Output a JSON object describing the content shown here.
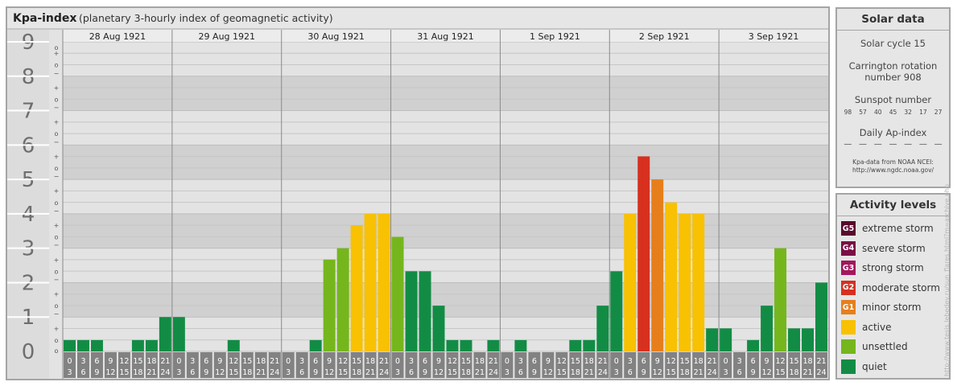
{
  "title": "Kpa-index",
  "subtitle": "(planetary 3-hourly index of geomagnetic activity)",
  "chart_data": {
    "type": "bar",
    "title": "Kpa-index",
    "subtitle": "(planetary 3-hourly index of geomagnetic activity)",
    "ylim": [
      0,
      9
    ],
    "y_ticks": [
      "0",
      "1",
      "2",
      "3",
      "4",
      "5",
      "6",
      "7",
      "8",
      "9"
    ],
    "y_subticks": [
      "+",
      "o",
      "−"
    ],
    "days": [
      "28 Aug 1921",
      "29 Aug 1921",
      "30 Aug 1921",
      "31 Aug 1921",
      "1 Sep 1921",
      "2 Sep 1921",
      "3 Sep 1921"
    ],
    "interval_starts": [
      "0",
      "3",
      "6",
      "9",
      "12",
      "15",
      "18",
      "21"
    ],
    "interval_ends": [
      "3",
      "6",
      "9",
      "12",
      "15",
      "18",
      "21",
      "24"
    ],
    "values": [
      [
        0.33,
        0.33,
        0.33,
        0,
        0,
        0.33,
        0.33,
        1
      ],
      [
        1,
        0,
        0,
        0,
        0.33,
        0,
        0,
        0
      ],
      [
        0,
        0,
        0.33,
        2.67,
        3,
        3.67,
        4,
        4
      ],
      [
        3.33,
        2.33,
        2.33,
        1.33,
        0.33,
        0.33,
        0,
        0.33
      ],
      [
        0,
        0.33,
        0,
        0,
        0,
        0.33,
        0.33,
        1.33
      ],
      [
        2.33,
        4,
        5.67,
        5,
        4.33,
        4,
        4,
        0.67
      ],
      [
        0.67,
        0,
        0.33,
        1.33,
        3,
        0.67,
        0.67,
        2
      ]
    ]
  },
  "solar": {
    "heading": "Solar data",
    "cycle": "Solar cycle 15",
    "rotation_line1": "Carrington rotation",
    "rotation_line2": "number 908",
    "sunspot_heading": "Sunspot number",
    "sunspots": [
      "98",
      "57",
      "40",
      "45",
      "32",
      "17",
      "27"
    ],
    "ap_heading": "Daily Ap-index",
    "ap_values": [
      "—",
      "—",
      "—",
      "—",
      "—",
      "—",
      "—"
    ],
    "source_line1": "Kpa-data from NOAA NCEI:",
    "source_line2": "http://www.ngdc.noaa.gov/"
  },
  "activity": {
    "heading": "Activity levels",
    "levels": [
      {
        "badge": "G5",
        "label": "extreme storm",
        "color": "#5a0a2d"
      },
      {
        "badge": "G4",
        "label": "severe storm",
        "color": "#7c0e46"
      },
      {
        "badge": "G3",
        "label": "strong storm",
        "color": "#a3175e"
      },
      {
        "badge": "G2",
        "label": "moderate storm",
        "color": "#d7301f"
      },
      {
        "badge": "G1",
        "label": "minor storm",
        "color": "#e67f1b"
      },
      {
        "badge": "",
        "label": "active",
        "color": "#f8c102"
      },
      {
        "badge": "",
        "label": "unsettled",
        "color": "#75b61d"
      },
      {
        "badge": "",
        "label": "quiet",
        "color": "#128c45"
      }
    ]
  },
  "watermark": "http://www.tesis.lebedev.ru/sun_flares.html?m=archive.php"
}
